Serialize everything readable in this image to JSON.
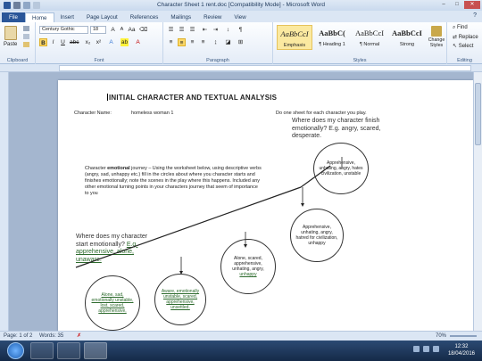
{
  "window": {
    "title": "Character Sheet 1 rent.doc [Compatibility Mode] - Microsoft Word",
    "minimize": "–",
    "maximize": "□",
    "close": "✕"
  },
  "ribbon": {
    "tabs": [
      "File",
      "Home",
      "Insert",
      "Page Layout",
      "References",
      "Mailings",
      "Review",
      "View"
    ],
    "active_tab": "Home",
    "clipboard": {
      "paste_label": "Paste",
      "group_label": "Clipboard"
    },
    "font": {
      "family": "Century Gothic",
      "size": "18",
      "bold": "B",
      "italic": "I",
      "underline": "U",
      "group_label": "Font"
    },
    "paragraph": {
      "group_label": "Paragraph",
      "pilcrow": "¶"
    },
    "styles": {
      "group_label": "Styles",
      "items": [
        {
          "sample": "AaBbCcI",
          "name": "Emphasis"
        },
        {
          "sample": "AaBbC(",
          "name": "¶ Heading 1"
        },
        {
          "sample": "AaBbCcI",
          "name": "¶ Normal"
        },
        {
          "sample": "AaBbCcI",
          "name": "Strong"
        }
      ],
      "change_styles": "Change Styles"
    },
    "editing": {
      "find": "Find",
      "replace": "Replace",
      "select": "Select",
      "group_label": "Editing"
    }
  },
  "document": {
    "title": "INITIAL CHARACTER AND TEXTUAL ANALYSIS",
    "character_name_label": "Character Name:",
    "character_name_value": "homeless woman 1",
    "one_sheet_note": "Do one sheet for each character you play.",
    "finish_question": "Where does my character finish emotionally? E.g. angry, scared, desperate.",
    "instructions_before": "Character ",
    "instructions_bold": "emotional",
    "instructions_after": " journey – Using the worksheet below, using descriptive verbs (angry, sad, unhappy etc.) fill in the circles about where you character starts and finishes emotionally; note the scenes in the play where this happens. Included any other emotional turning points in your characters journey that seem of importance to you",
    "start_question_plain": "Where does my character start emotionally? ",
    "start_question_green": "E.g. apprehensive, alone, unaware.",
    "circles": [
      {
        "text": "Alone, sad, emotionally unstable, lost, scared, apprehensive,"
      },
      {
        "text": "Aware, emotionally unstable, scared, apprehensive, unsettled."
      },
      {
        "text_plain": "Alone, scared, apprehensive, unhating, angry, ",
        "text_green": "unhappy"
      },
      {
        "text": "Apprehensive, unhating, angry, hatred for civilization, unhappy"
      },
      {
        "text": "Apprehensive, unhating, angry, hates civilization, unstable"
      }
    ]
  },
  "status": {
    "page": "Page: 1 of 2",
    "words": "Words: 35",
    "zoom": "70%"
  },
  "taskbar": {
    "time": "12:32",
    "date": "18/04/2016"
  }
}
